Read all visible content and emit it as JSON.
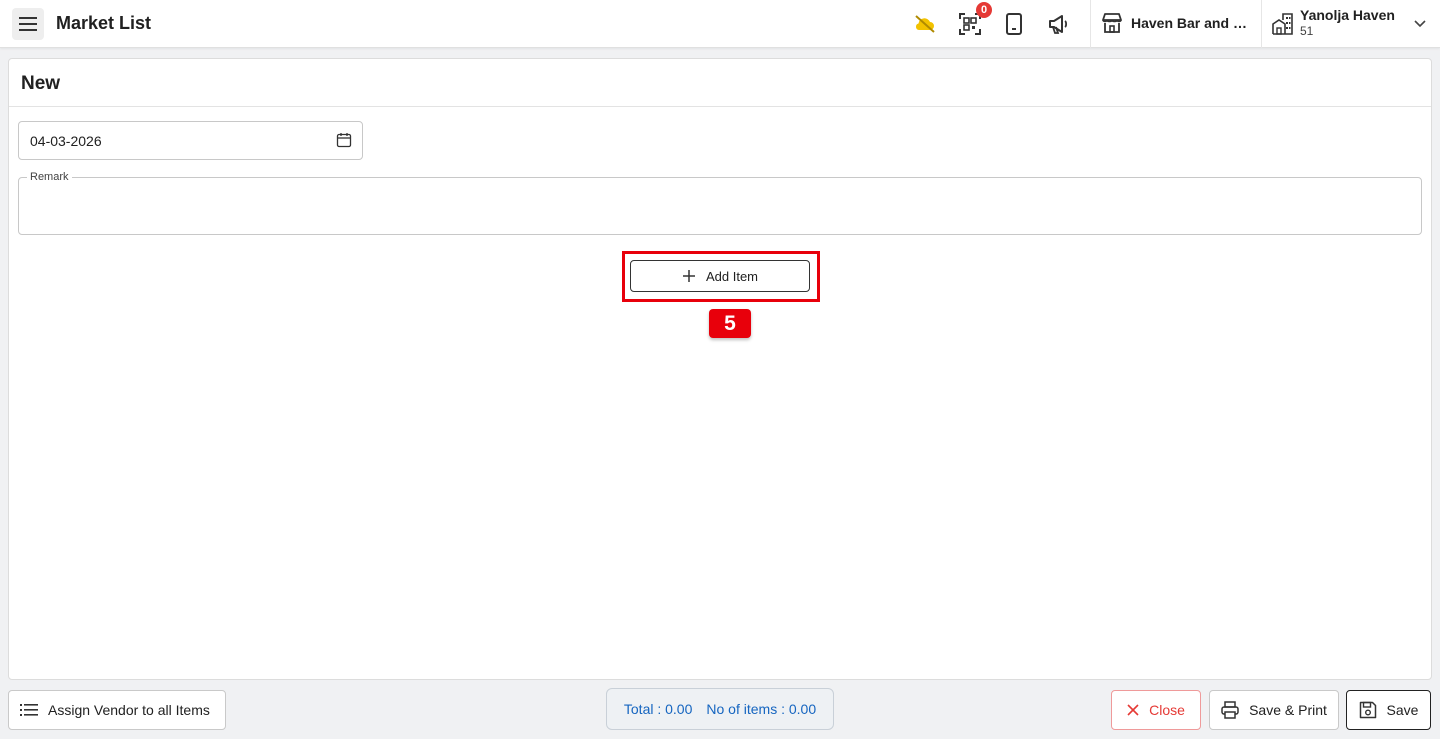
{
  "header": {
    "title": "Market List",
    "notification_count": "0",
    "outlet_name": "Haven Bar and R...",
    "property_name": "Yanolja Haven",
    "property_sub": "51",
    "icons": [
      "menu-icon",
      "cloud-off-icon",
      "qr-code-icon",
      "tablet-icon",
      "megaphone-icon",
      "store-icon",
      "building-icon",
      "chevron-down-icon"
    ]
  },
  "form": {
    "title": "New",
    "date_value": "04-03-2026",
    "remark_label": "Remark",
    "remark_value": "",
    "add_item_label": "Add Item"
  },
  "annotation": {
    "step_number": "5",
    "color": "#e8000b"
  },
  "footer": {
    "assign_vendor_label": "Assign Vendor to all Items",
    "total_text": "Total : 0.00",
    "items_text": "No of items : 0.00",
    "close_label": "Close",
    "save_print_label": "Save & Print",
    "save_label": "Save"
  },
  "colors": {
    "accent_blue": "#1565c0",
    "danger": "#e53935",
    "cloud_yellow": "#f2c200"
  }
}
